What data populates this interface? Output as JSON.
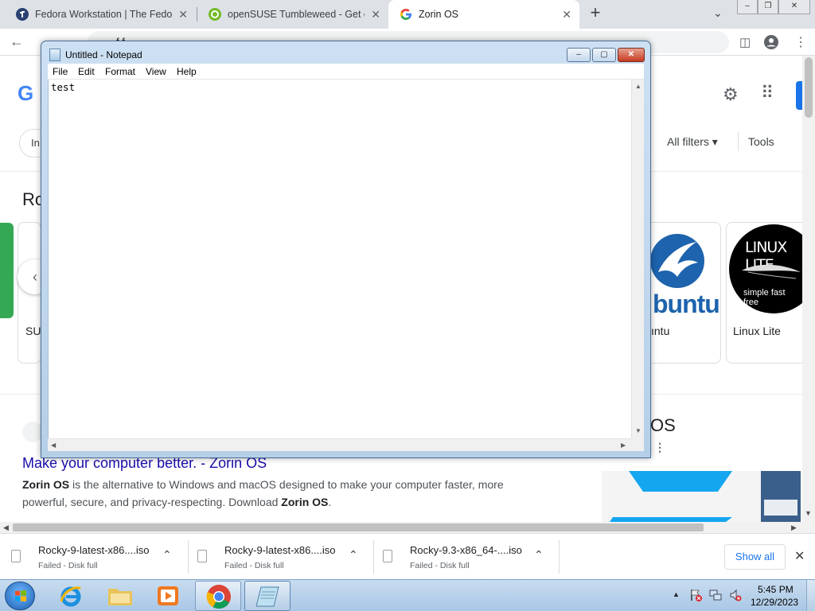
{
  "browser": {
    "tabs": [
      {
        "title": "Fedora Workstation | The Fedora",
        "close": "✕"
      },
      {
        "title": "openSUSE Tumbleweed - Get op",
        "close": "✕"
      },
      {
        "title": "Zorin OS",
        "close": "✕"
      }
    ],
    "new_tab": "+",
    "tab_menu": "⌄",
    "window_controls": {
      "minimize": "‒",
      "restore": "❐",
      "close": "✕"
    },
    "address_text": "f  f",
    "colors": {
      "accent": "#1a73e8",
      "tab_strip": "#dee1e6"
    }
  },
  "page": {
    "logo_fragment": "G",
    "chip_fragment": "In",
    "all_filters": "All filters",
    "tools": "Tools",
    "section_title_fragment": "Ro",
    "cards": [
      {
        "label": "SU"
      },
      {
        "label": "ıntu"
      },
      {
        "label": "Linux Lite"
      }
    ],
    "ubuntu_logo_text": "buntu",
    "linux_lite": {
      "title": "LINUX LITE",
      "subtitle": "simple fast free"
    },
    "result": {
      "link": "Make your computer better. - Zorin OS",
      "snippet_bold": "Zorin OS",
      "snippet_mid": " is the alternative to Windows and macOS designed to make your computer faster, more powerful, secure, and privacy-respecting. Download ",
      "snippet_bold2": "Zorin OS",
      "snippet_end": "."
    },
    "side_fragment": "OS",
    "side_dots": "⋮"
  },
  "downloads": {
    "items": [
      {
        "name": "Rocky-9-latest-x86....iso",
        "status": "Failed - Disk full"
      },
      {
        "name": "Rocky-9-latest-x86....iso",
        "status": "Failed - Disk full"
      },
      {
        "name": "Rocky-9.3-x86_64-....iso",
        "status": "Failed - Disk full"
      }
    ],
    "show_all": "Show all",
    "close": "✕"
  },
  "notepad": {
    "title": "Untitled - Notepad",
    "menu": [
      "File",
      "Edit",
      "Format",
      "View",
      "Help"
    ],
    "content": "test",
    "controls": {
      "minimize": "‒",
      "maximize": "▢",
      "close": "✕"
    }
  },
  "taskbar": {
    "apps": [
      "internet-explorer",
      "file-explorer",
      "media-player",
      "chrome",
      "notepad"
    ],
    "clock_time": "5:45 PM",
    "clock_date": "12/29/2023"
  }
}
